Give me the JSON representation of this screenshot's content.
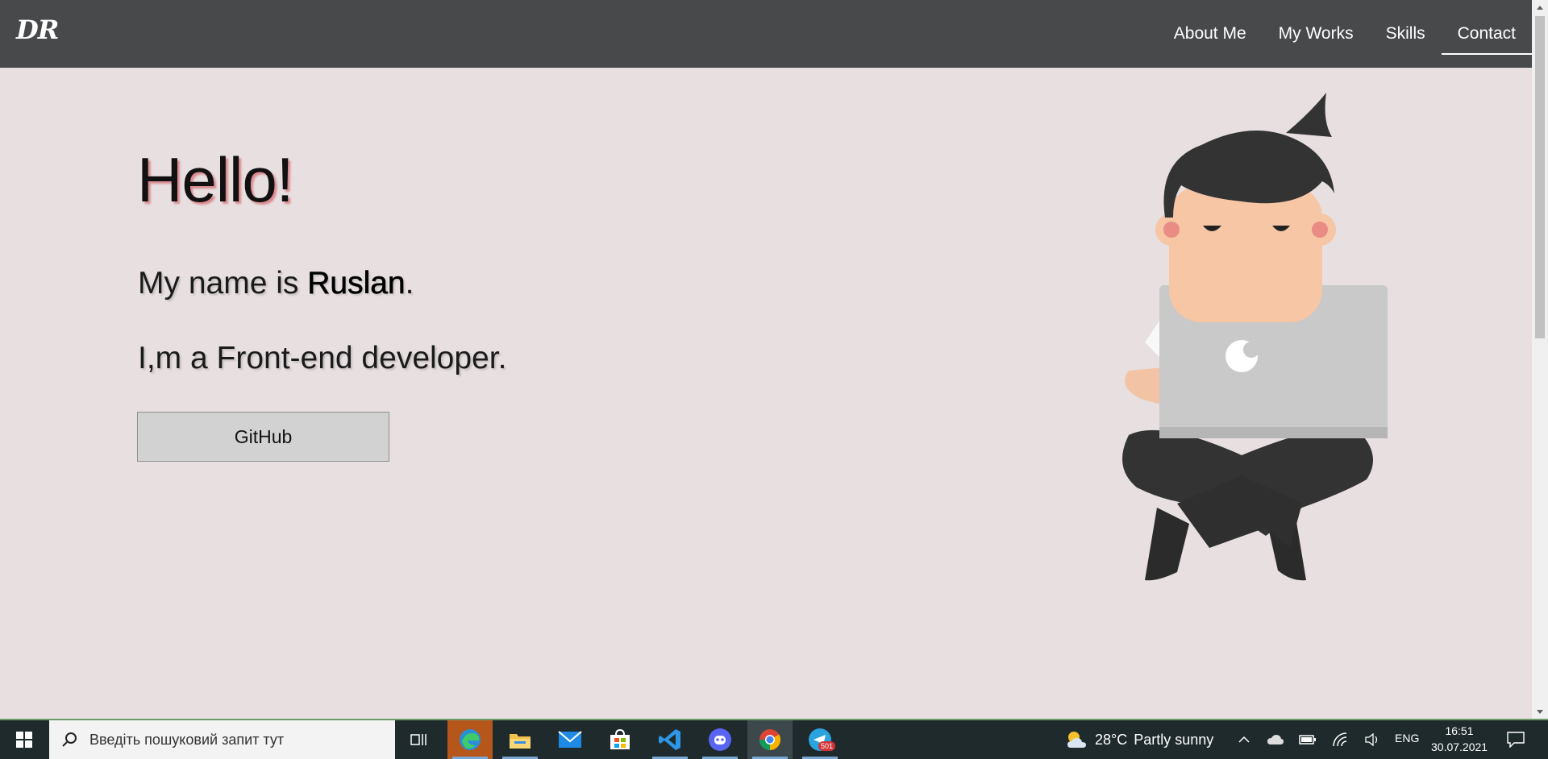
{
  "header": {
    "logo": "DR",
    "nav": [
      {
        "label": "About Me"
      },
      {
        "label": "My Works"
      },
      {
        "label": "Skills"
      },
      {
        "label": "Contact"
      }
    ]
  },
  "hero": {
    "title": "Hello!",
    "intro_prefix": "My name is ",
    "name": "Ruslan",
    "intro_suffix": ".",
    "role": "I,m a Front-end developer.",
    "button_label": "GitHub"
  },
  "colors": {
    "header_bg": "#47494b",
    "page_bg": "#e7dfe0",
    "button_bg": "#d2d2d2",
    "taskbar_bg": "#1f2a2d"
  },
  "taskbar": {
    "search_placeholder": "Введіть пошуковий запит тут",
    "pinned": [
      {
        "icon": "task-view-icon"
      },
      {
        "icon": "edge-icon"
      },
      {
        "icon": "file-explorer-icon"
      },
      {
        "icon": "mail-icon"
      },
      {
        "icon": "store-icon"
      },
      {
        "icon": "vscode-icon"
      },
      {
        "icon": "discord-icon"
      },
      {
        "icon": "chrome-icon"
      },
      {
        "icon": "telegram-icon",
        "badge": "501"
      }
    ],
    "weather": {
      "temp": "28°C",
      "condition": "Partly sunny"
    },
    "language": "ENG",
    "time": "16:51",
    "date": "30.07.2021"
  }
}
